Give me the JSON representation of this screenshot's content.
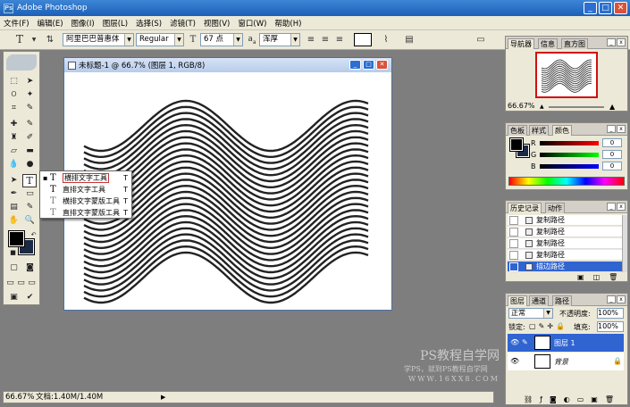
{
  "app": {
    "title": "Adobe Photoshop"
  },
  "menu": [
    "文件(F)",
    "编辑(E)",
    "图像(I)",
    "图层(L)",
    "选择(S)",
    "滤镜(T)",
    "视图(V)",
    "窗口(W)",
    "帮助(H)"
  ],
  "options": {
    "tool_glyph": "T",
    "font_family": "阿里巴巴普惠体",
    "font_style": "Regular",
    "font_size": "67 点",
    "aa_label": "a",
    "aa_sub": "a",
    "aa_value": "浑厚"
  },
  "document": {
    "title": "未标题-1 @ 66.7% (图层 1, RGB/8)"
  },
  "flyout": {
    "items": [
      {
        "glyph": "T",
        "label": "横排文字工具",
        "shortcut": "T"
      },
      {
        "glyph": "T",
        "label": "直排文字工具",
        "shortcut": "T"
      },
      {
        "glyph": "T",
        "label": "横排文字蒙版工具",
        "shortcut": "T"
      },
      {
        "glyph": "T",
        "label": "直排文字蒙版工具",
        "shortcut": "T"
      }
    ]
  },
  "navigator": {
    "tabs": [
      "导航器",
      "信息",
      "直方图"
    ],
    "zoom": "66.67%"
  },
  "color_panel": {
    "tabs": [
      "色板",
      "样式",
      "颜色"
    ],
    "channels": [
      {
        "label": "R",
        "value": "0",
        "color": "#cc0000"
      },
      {
        "label": "G",
        "value": "0",
        "color": "#00aa00"
      },
      {
        "label": "B",
        "value": "0",
        "color": "#0000cc"
      }
    ]
  },
  "history": {
    "tabs": [
      "历史记录",
      "动作"
    ],
    "items": [
      "复制路径",
      "复制路径",
      "复制路径",
      "复制路径",
      "复制路径",
      "描边路径"
    ],
    "selected_index": 5
  },
  "layers": {
    "tabs": [
      "图层",
      "通道",
      "路径"
    ],
    "blend_mode": "正常",
    "opacity_label": "不透明度:",
    "opacity": "100%",
    "lock_label": "锁定:",
    "fill_label": "填充:",
    "fill": "100%",
    "items": [
      {
        "name": "图层 1",
        "selected": true
      },
      {
        "name": "背景",
        "selected": false,
        "italic": true
      }
    ]
  },
  "status": {
    "zoom": "66.67%",
    "doc_info": "文档:1.40M/1.40M"
  },
  "watermark": {
    "line1": "PS教程自学网",
    "line2": "学PS，就到PS教程自学网",
    "line3": "WWW.16XX8.COM"
  },
  "colors": {
    "accent": "#3064d1",
    "titlebar": "#1d5fb8",
    "chrome": "#ece9d8",
    "workspace": "#7e7e7e"
  }
}
